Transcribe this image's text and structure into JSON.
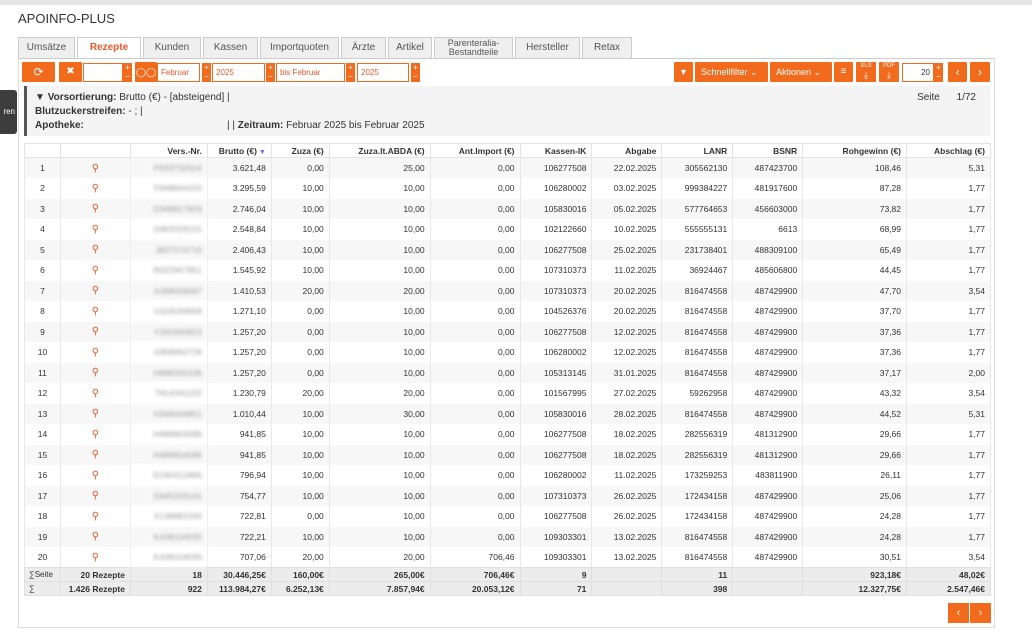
{
  "app": {
    "title": "APOINFO-PLUS",
    "side_tab_label": "ren"
  },
  "tabs": [
    {
      "label": "Umsätze",
      "active": false
    },
    {
      "label": "Rezepte",
      "active": true
    },
    {
      "label": "Kunden",
      "active": false
    },
    {
      "label": "Kassen",
      "active": false
    },
    {
      "label": "Importquoten",
      "active": false
    },
    {
      "label": "Ärzte",
      "active": false
    },
    {
      "label": "Artikel",
      "active": false
    },
    {
      "label": "Parenteralia-\nBestandteile",
      "active": false
    },
    {
      "label": "Hersteller",
      "active": false
    },
    {
      "label": "Retax",
      "active": false
    }
  ],
  "toolbar": {
    "refresh_icon": "refresh-icon",
    "clear_icon": "close-icon",
    "from_month": "Februar",
    "from_year": "2025",
    "to_month": "bis Februar",
    "to_year": "2025",
    "quickfilter_label": "Schnellfilter",
    "actions_label": "Aktionen",
    "xls_label": "XLS",
    "pdf_label": "PDF",
    "page_size": "20",
    "accent": "#f26a1b"
  },
  "sort_panel": {
    "presort_label": "Vorsortierung:",
    "presort_value": "Brutto (€) - [absteigend] |",
    "bz_label": "Blutzuckerstreifen:",
    "bz_value": "- ; |",
    "apotheke_label": "Apotheke:",
    "apotheke_value": "| |",
    "zeitraum_label": "Zeitraum:",
    "zeitraum_value": "Februar 2025 bis Februar 2025",
    "page_label": "Seite",
    "page_value": "1/72"
  },
  "table": {
    "headers": [
      "",
      "",
      "Vers.-Nr.",
      "Brutto (€)",
      "Zuza (€)",
      "Zuza.lt.ABDA (€)",
      "Ant.Import (€)",
      "Kassen-IK",
      "Abgabe",
      "LANR",
      "BSNR",
      "Rohgewinn (€)",
      "Abschlag (€)"
    ],
    "rows": [
      [
        "1",
        "P833732914",
        "3.621,48",
        "0,00",
        "25,00",
        "0,00",
        "106277508",
        "22.02.2025",
        "305562130",
        "487423700",
        "108,46",
        "5,31"
      ],
      [
        "2",
        "F848844103",
        "3.295,59",
        "10,00",
        "10,00",
        "0,00",
        "106280002",
        "03.02.2025",
        "999384227",
        "481917600",
        "87,28",
        "1,77"
      ],
      [
        "3",
        "D348817829",
        "2.746,04",
        "10,00",
        "10,00",
        "0,00",
        "105830016",
        "05.02.2025",
        "577764653",
        "456603000",
        "73,82",
        "1,77"
      ],
      [
        "4",
        "G803329115",
        "2.548,84",
        "10,00",
        "10,00",
        "0,00",
        "102122660",
        "10.02.2025",
        "555555131",
        "6613",
        "68,99",
        "1,77"
      ],
      [
        "5",
        "J837574715",
        "2.406,43",
        "10,00",
        "10,00",
        "0,00",
        "106277508",
        "25.02.2025",
        "231738401",
        "488309100",
        "65,49",
        "1,77"
      ],
      [
        "6",
        "R022947851",
        "1.545,92",
        "10,00",
        "10,00",
        "0,00",
        "107310373",
        "11.02.2025",
        "36924467",
        "485606800",
        "44,45",
        "1,77"
      ],
      [
        "7",
        "A398058087",
        "1.410,53",
        "20,00",
        "20,00",
        "0,00",
        "107310373",
        "20.02.2025",
        "816474558",
        "487429900",
        "47,70",
        "3,54"
      ],
      [
        "8",
        "U118194658",
        "1.271,10",
        "0,00",
        "10,00",
        "0,00",
        "104526376",
        "20.02.2025",
        "816474558",
        "487429900",
        "37,70",
        "1,77"
      ],
      [
        "9",
        "Y200390823",
        "1.257,20",
        "0,00",
        "10,00",
        "0,00",
        "106277508",
        "12.02.2025",
        "816474558",
        "487429900",
        "37,36",
        "1,77"
      ],
      [
        "10",
        "X858850728",
        "1.257,20",
        "0,00",
        "10,00",
        "0,00",
        "106280002",
        "12.02.2025",
        "816474558",
        "487429900",
        "37,36",
        "1,77"
      ],
      [
        "11",
        "H898300106",
        "1.257,20",
        "0,00",
        "10,00",
        "0,00",
        "105313145",
        "31.01.2025",
        "816474558",
        "487429900",
        "37,17",
        "2,00"
      ],
      [
        "12",
        "T814341162",
        "1.230,79",
        "20,00",
        "20,00",
        "0,00",
        "101567995",
        "27.02.2025",
        "59262958",
        "487429900",
        "43,32",
        "3,54"
      ],
      [
        "13",
        "H348444851",
        "1.010,44",
        "10,00",
        "30,00",
        "0,00",
        "105830016",
        "28.02.2025",
        "816474558",
        "487429900",
        "44,52",
        "5,31"
      ],
      [
        "14",
        "H489804586",
        "941,85",
        "10,00",
        "10,00",
        "0,00",
        "106277508",
        "18.02.2025",
        "282556319",
        "481312900",
        "29,66",
        "1,77"
      ],
      [
        "15",
        "H489804586",
        "941,85",
        "10,00",
        "10,00",
        "0,00",
        "106277508",
        "18.02.2025",
        "282556319",
        "481312900",
        "29,66",
        "1,77"
      ],
      [
        "16",
        "D190312865",
        "796,94",
        "10,00",
        "10,00",
        "0,00",
        "106280002",
        "11.02.2025",
        "173259253",
        "483811900",
        "26,11",
        "1,77"
      ],
      [
        "17",
        "E845339141",
        "754,77",
        "10,00",
        "10,00",
        "0,00",
        "107310373",
        "26.02.2025",
        "172434158",
        "487429900",
        "25,06",
        "1,77"
      ],
      [
        "18",
        "X138981550",
        "722,81",
        "0,00",
        "10,00",
        "0,00",
        "106277508",
        "26.02.2025",
        "172434158",
        "487429900",
        "24,28",
        "1,77"
      ],
      [
        "19",
        "K438104035",
        "722,21",
        "10,00",
        "10,00",
        "0,00",
        "109303301",
        "13.02.2025",
        "816474558",
        "487429900",
        "24,28",
        "1,77"
      ],
      [
        "20",
        "K438104035",
        "707,06",
        "20,00",
        "20,00",
        "706,46",
        "109303301",
        "13.02.2025",
        "816474558",
        "487429900",
        "30,51",
        "3,54"
      ]
    ],
    "footer": [
      [
        "∑Seite",
        "20 Rezepte",
        "18",
        "30.446,25€",
        "160,00€",
        "265,00€",
        "706,46€",
        "9",
        "",
        "11",
        "",
        "923,18€",
        "48,02€"
      ],
      [
        "∑",
        "1.426 Rezepte",
        "922",
        "113.984,27€",
        "6.252,13€",
        "7.857,94€",
        "20.053,12€",
        "71",
        "",
        "398",
        "",
        "12.327,75€",
        "2.547,46€"
      ]
    ]
  },
  "pager": {
    "prev_icon": "chevron-left-icon",
    "next_icon": "chevron-right-icon"
  }
}
